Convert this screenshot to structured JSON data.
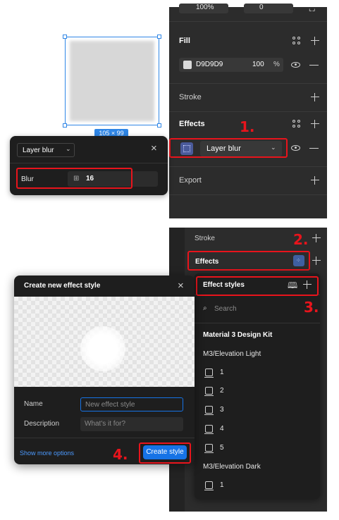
{
  "top_panel": {
    "partial_row": {
      "value1": "100%",
      "value2": "0"
    },
    "fill": {
      "title": "Fill",
      "color_hex": "D9D9D9",
      "swatch": "#d9d9d9",
      "opacity": "100",
      "percent": "%"
    },
    "stroke": {
      "title": "Stroke"
    },
    "effects": {
      "title": "Effects",
      "effect_type": "Layer blur"
    },
    "export": {
      "title": "Export"
    }
  },
  "canvas": {
    "size_badge": "105 × 99"
  },
  "blur_popup": {
    "type": "Layer blur",
    "blur_label": "Blur",
    "blur_value": "16"
  },
  "bottom_panel": {
    "stroke_title": "Stroke",
    "effects_title": "Effects"
  },
  "effect_styles": {
    "title": "Effect styles",
    "search_placeholder": "Search",
    "kit_title": "Material 3 Design Kit",
    "groups": [
      {
        "name": "M3/Elevation Light",
        "items": [
          "1",
          "2",
          "3",
          "4",
          "5"
        ]
      },
      {
        "name": "M3/Elevation Dark",
        "items": [
          "1"
        ]
      }
    ]
  },
  "create_dialog": {
    "title": "Create new effect style",
    "name_label": "Name",
    "name_placeholder": "New effect style",
    "description_label": "Description",
    "description_placeholder": "What's it for?",
    "show_more": "Show more options",
    "create_button": "Create style"
  },
  "annotations": {
    "step1": "1.",
    "step2": "2.",
    "step3": "3.",
    "step4": "4."
  },
  "colors": {
    "accent": "#1673e6",
    "annotation_red": "#e8141c",
    "panel_bg": "#2c2c2c",
    "selection_blue": "#2f86e6"
  }
}
